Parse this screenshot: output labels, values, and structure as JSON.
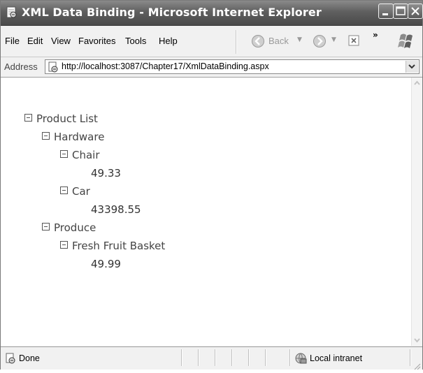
{
  "window": {
    "title": "XML Data Binding - Microsoft Internet Explorer"
  },
  "menu": {
    "items": [
      "File",
      "Edit",
      "View",
      "Favorites",
      "Tools",
      "Help"
    ]
  },
  "toolbar": {
    "back_label": "Back"
  },
  "address": {
    "label": "Address",
    "url": "http://localhost:3087/Chapter17/XmlDataBinding.aspx"
  },
  "tree": {
    "root": "Product List",
    "categories": [
      {
        "name": "Hardware",
        "products": [
          {
            "name": "Chair",
            "price": "49.33"
          },
          {
            "name": "Car",
            "price": "43398.55"
          }
        ]
      },
      {
        "name": "Produce",
        "products": [
          {
            "name": "Fresh Fruit Basket",
            "price": "49.99"
          }
        ]
      }
    ]
  },
  "status": {
    "text": "Done",
    "zone": "Local intranet"
  },
  "icons": {
    "app": "ie-page-icon",
    "minimize": "minimize-icon",
    "maximize": "maximize-icon",
    "close": "close-icon",
    "back": "back-arrow-icon",
    "forward": "forward-arrow-icon",
    "stop": "stop-icon",
    "logo": "windows-flag-icon",
    "zone": "intranet-icon"
  }
}
